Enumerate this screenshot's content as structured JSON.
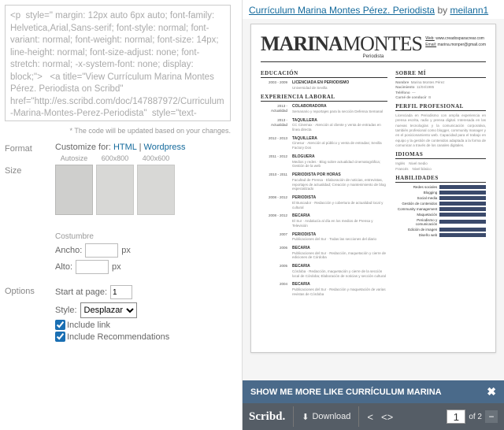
{
  "embed_code": "<p  style=\" margin: 12px auto 6px auto; font-family: Helvetica,Arial,Sans-serif; font-style: normal; font-variant: normal; font-weight: normal; font-size: 14px; line-height: normal; font-size-adjust: none; font-stretch: normal; -x-system-font: none; display: block;\">   <a title=\"View Currículum Marina Montes Pérez. Periodista on Scribd\" href=\"http://es.scribd.com/doc/147887972/Curriculum-Marina-Montes-Perez-Periodista\"  style=\"text-decoration: underline;\"",
  "note": "* The code will be updated based on your changes.",
  "format": {
    "label": "Format",
    "prefix": "Customize for:",
    "html": "HTML",
    "wp": "Wordpress"
  },
  "size": {
    "label": "Size",
    "opts": [
      "Autosize",
      "600x800",
      "400x600"
    ],
    "custom": "Costumbre",
    "w_label": "Ancho:",
    "h_label": "Alto:",
    "unit": "px",
    "w": "",
    "h": ""
  },
  "options": {
    "label": "Options",
    "start": "Start at page:",
    "start_val": "1",
    "style": "Style:",
    "style_val": "Desplazar",
    "link": "Include link",
    "rec": "Include Recommendations"
  },
  "title": {
    "doc": "Currículum Marina Montes Pérez. Periodista",
    "by": "by",
    "author": "meilann1"
  },
  "cv": {
    "first": "MARINA",
    "last": "MONTES",
    "role": "Periodista",
    "web_k": "Web:",
    "web_v": "www.creadosparacrear.com",
    "email_k": "Email:",
    "email_v": "marina.monper@gmail.com",
    "edu_h": "EDUCACIÓN",
    "edu": [
      {
        "y": "2003 - 2009",
        "t": "LICENCIADA EN PERIODISMO",
        "d": "Universidad de Sevilla"
      }
    ],
    "exp_h": "EXPERIENCIA LABORAL",
    "exp": [
      {
        "y": "2013 - Actualidad",
        "t": "COLABORADORA",
        "d": "Semanario y reportajes para la sección Defensa Semanal"
      },
      {
        "y": "2013 - Actualidad",
        "t": "TAQUILLERA",
        "d": "CC Cinemax · Atención al cliente y venta de entradas en línea directa"
      },
      {
        "y": "2012 - 2013",
        "t": "TAQUILLERA",
        "d": "Cinesur · Atención al público y venta de entradas; Sevilla Factory Dos"
      },
      {
        "y": "2011 - 2012",
        "t": "BLOGUERA",
        "d": "Medios y redes · Blog sobre actualidad cinematográfica; Gestión de la web"
      },
      {
        "y": "2010 - 2011",
        "t": "PERIODISTA POR HORAS",
        "d": "Facultad de Prensa · Elaboración de noticias, entrevistas, reportajes de actualidad; Creación y mantenimiento de blog especializado"
      },
      {
        "y": "2008 - 2012",
        "t": "PERIODISTA",
        "d": "El Buscador · Redacción y cobertura de actualidad local y cultural"
      },
      {
        "y": "2008 - 2012",
        "t": "BECARIA",
        "d": "El Sur · Andalucía al día en los medios de Prensa y Televisión"
      },
      {
        "y": "2007",
        "t": "PERIODISTA",
        "d": "Publicaciones del Sur · Todas las secciones del diario"
      },
      {
        "y": "2006",
        "t": "BECARIA",
        "d": "Publicaciones del Sur · Redacción, maquetación y cierre de ediciones de Córdoba"
      },
      {
        "y": "2005",
        "t": "BECARIA",
        "d": "Córdoba · Redacción, maquetación y cierre de la sección local de Córdoba; Elaboración de noticias y sección cultural"
      },
      {
        "y": "2004",
        "t": "BECARIA",
        "d": "Publicaciones del Sur · Redacción y maquetación de varias revistas de Córdoba"
      }
    ],
    "about_h": "SOBRE MÍ",
    "about": [
      [
        "Nombre",
        "Marina Montes Pérez"
      ],
      [
        "Nacimiento",
        "11/04/1985"
      ],
      [
        "Teléfono",
        "—"
      ],
      [
        "Carné de conducir",
        "B"
      ]
    ],
    "prof_h": "PERFIL PROFESIONAL",
    "prof": "Licenciada en Periodismo con amplia experiencia en prensa escrita, radio y prensa digital. Interesada en las nuevas tecnologías y la comunicación corporativa, también profesional como blogger, community manager y en el posicionamiento web. Capacidad para el trabajo en equipo y la gestión de contenidos adaptada a la forma de comunicar a través de los canales digitales.",
    "lang_h": "IDIOMAS",
    "lang": [
      [
        "Inglés",
        "Nivel medio"
      ],
      [
        "Francés",
        "Nivel básico"
      ]
    ],
    "skill_h": "HABILIDADES",
    "skills": [
      [
        "Redes sociales",
        92
      ],
      [
        "Blogging",
        96
      ],
      [
        "Social media",
        94
      ],
      [
        "Gestión de contenidos",
        98
      ],
      [
        "Community management",
        96
      ],
      [
        "Maquetación",
        70
      ],
      [
        "Periodismo y comunicación",
        98
      ],
      [
        "Edición de imagen",
        55
      ],
      [
        "Diseño web",
        50
      ]
    ]
  },
  "showmore": "SHOW ME MORE LIKE CURRÍCULUM MARINA",
  "toolbar": {
    "brand": "Scribd.",
    "download": "Download",
    "page": "1",
    "total": "of 2"
  }
}
